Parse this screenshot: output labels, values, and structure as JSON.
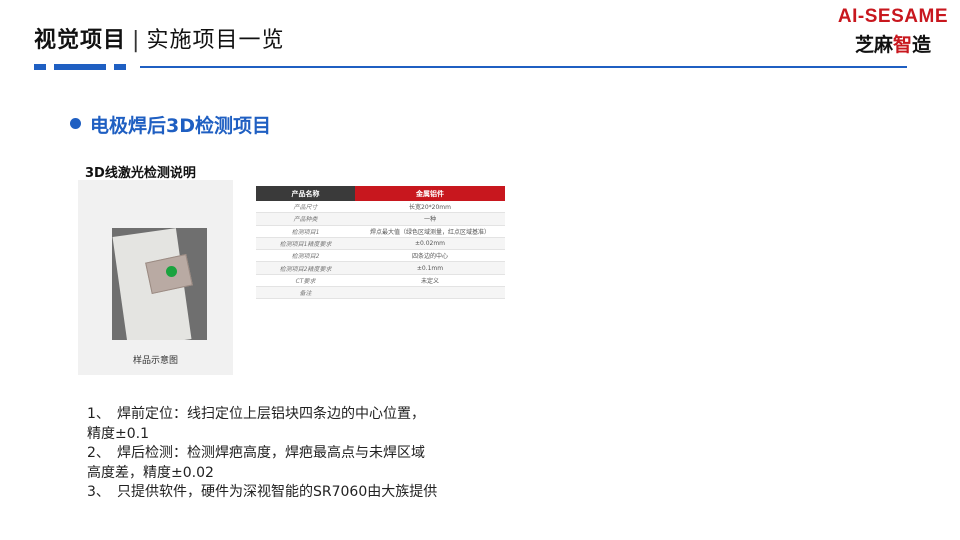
{
  "header": {
    "title_main": "视觉项目",
    "separator": "|",
    "title_sub": "实施项目一览"
  },
  "logo": {
    "line1": "AI-SESAME",
    "line2_a": "芝麻",
    "line2_b": "智",
    "line2_c": "造"
  },
  "colors": {
    "accent_blue": "#1f5fc2",
    "brand_red": "#c8171e"
  },
  "section": {
    "title": "电极焊后3D检测项目"
  },
  "card": {
    "caption": "3D线激光检测说明",
    "photo_caption": "样品示意图"
  },
  "spec_table": {
    "headers": [
      "产品名称",
      "金属铝件"
    ],
    "rows": [
      [
        "产品尺寸",
        "长宽20*20mm"
      ],
      [
        "产品种类",
        "一种"
      ],
      [
        "检测项目1",
        "焊点最大值（绿色区域测量，红点区域基准）"
      ],
      [
        "检测项目1精度要求",
        "±0.02mm"
      ],
      [
        "检测项目2",
        "四条边的中心"
      ],
      [
        "检测项目2精度要求",
        "±0.1mm"
      ],
      [
        "CT要求",
        "未定义"
      ],
      [
        "备注",
        ""
      ]
    ]
  },
  "notes": [
    {
      "num": "1、",
      "text": "焊前定位：线扫定位上层铝块四条边的中心位置，",
      "cont": "精度±0.1"
    },
    {
      "num": "2、",
      "text": "焊后检测：检测焊疤高度，焊疤最高点与未焊区域",
      "cont": "高度差，精度±0.02"
    },
    {
      "num": "3、",
      "text": "只提供软件，硬件为深视智能的SR7060由大族提供",
      "cont": ""
    }
  ]
}
